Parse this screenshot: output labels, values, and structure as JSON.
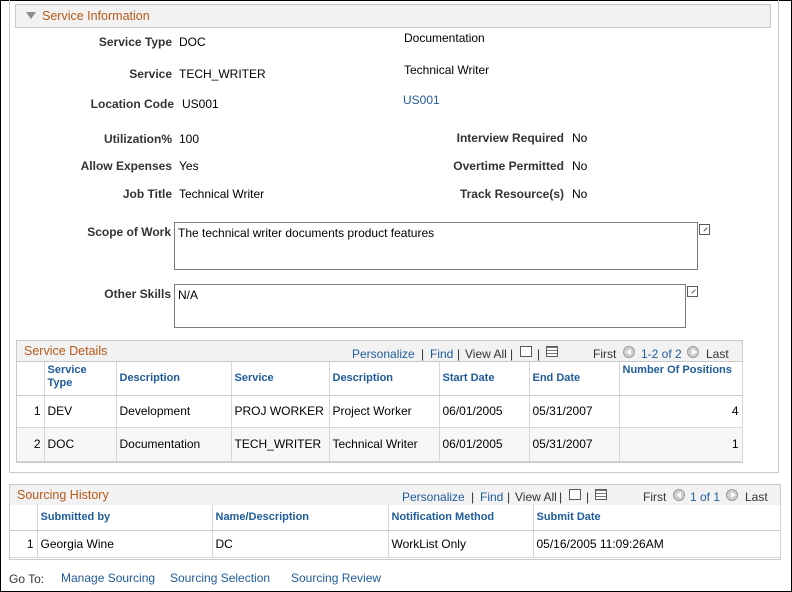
{
  "service_info": {
    "section_title": "Service Information",
    "service_type_label": "Service Type",
    "service_type_value": "DOC",
    "service_type_desc": "Documentation",
    "service_label": "Service",
    "service_value": "TECH_WRITER",
    "service_desc": "Technical Writer",
    "location_code_label": "Location Code",
    "location_code_value": "US001",
    "location_code_link": "US001",
    "utilization_label": "Utilization%",
    "utilization_value": "100",
    "allow_expenses_label": "Allow Expenses",
    "allow_expenses_value": "Yes",
    "job_title_label": "Job Title",
    "job_title_value": "Technical Writer",
    "interview_required_label": "Interview Required",
    "interview_required_value": "No",
    "overtime_permitted_label": "Overtime Permitted",
    "overtime_permitted_value": "No",
    "track_resources_label": "Track Resource(s)",
    "track_resources_value": "No",
    "scope_of_work_label": "Scope of Work",
    "scope_of_work_value": "The technical writer documents product features",
    "other_skills_label": "Other Skills",
    "other_skills_value": "N/A"
  },
  "service_details": {
    "title": "Service Details",
    "nav": {
      "personalize": "Personalize",
      "find": "Find",
      "view_all": "View All",
      "first": "First",
      "range": "1-2 of 2",
      "last": "Last"
    },
    "columns": [
      "",
      "Service Type",
      "Description",
      "Service",
      "Description",
      "Start Date",
      "End Date",
      "Number Of Positions"
    ],
    "rows": [
      [
        "1",
        "DEV",
        "Development",
        "PROJ WORKER",
        "Project Worker",
        "06/01/2005",
        "05/31/2007",
        "4"
      ],
      [
        "2",
        "DOC",
        "Documentation",
        "TECH_WRITER",
        "Technical Writer",
        "06/01/2005",
        "05/31/2007",
        "1"
      ]
    ]
  },
  "sourcing_history": {
    "title": "Sourcing History",
    "nav": {
      "personalize": "Personalize",
      "find": "Find",
      "view_all": "View All",
      "first": "First",
      "range": "1 of 1",
      "last": "Last"
    },
    "columns": [
      "",
      "Submitted by",
      "Name/Description",
      "Notification Method",
      "Submit Date"
    ],
    "rows": [
      [
        "1",
        "Georgia Wine",
        "DC",
        "WorkList Only",
        "05/16/2005 11:09:26AM"
      ]
    ]
  },
  "footer": {
    "goto_label": "Go To:",
    "links": [
      "Manage Sourcing",
      "Sourcing Selection",
      "Sourcing Review"
    ]
  }
}
